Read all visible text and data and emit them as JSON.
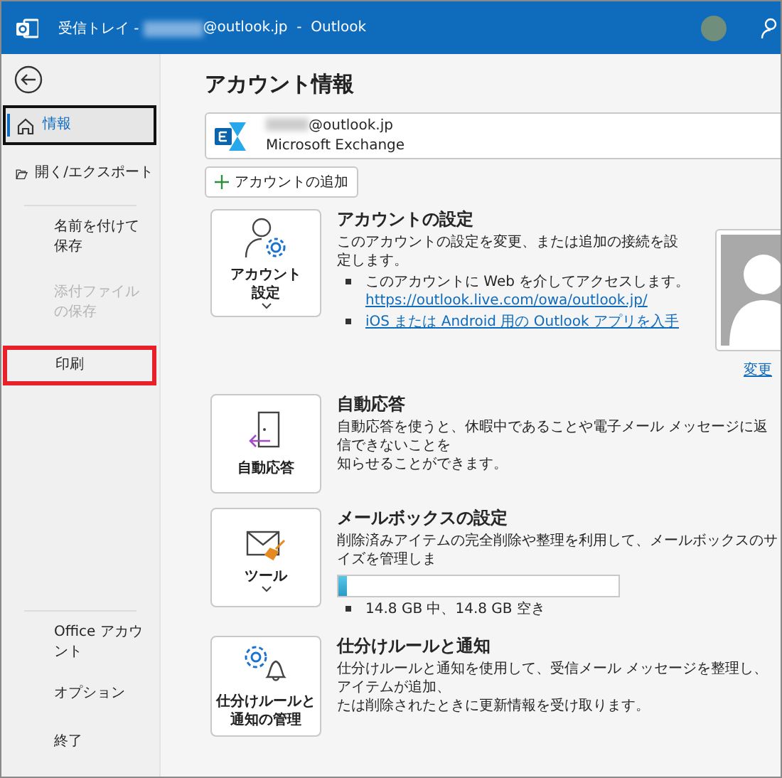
{
  "window": {
    "title_prefix": "受信トレイ -",
    "title_suffix": "@outlook.jp  -  Outlook"
  },
  "sidebar": {
    "top_items": [
      {
        "label": "情報",
        "selected": true,
        "disabled": false,
        "highlighted": false
      },
      {
        "label": "開く/エクスポート",
        "selected": false,
        "disabled": false,
        "highlighted": false
      }
    ],
    "file_items": [
      {
        "label": "名前を付けて保存",
        "selected": false,
        "disabled": false,
        "highlighted": false
      },
      {
        "label": "添付ファイルの保存",
        "selected": false,
        "disabled": true,
        "highlighted": false
      },
      {
        "label": "印刷",
        "selected": false,
        "disabled": false,
        "highlighted": true
      }
    ],
    "bottom_items": [
      {
        "label": "Office アカウント",
        "selected": false,
        "disabled": false,
        "highlighted": false
      },
      {
        "label": "オプション",
        "selected": false,
        "disabled": false,
        "highlighted": false
      },
      {
        "label": "終了",
        "selected": false,
        "disabled": false,
        "highlighted": false
      }
    ]
  },
  "main": {
    "heading": "アカウント情報",
    "account": {
      "email": "@outlook.jp",
      "type": "Microsoft Exchange"
    },
    "add_account": "アカウントの追加",
    "cards": [
      {
        "kind": "account-settings",
        "button": [
          "アカウント",
          "設定"
        ],
        "dropdown": true,
        "title": "アカウントの設定",
        "description": [
          "このアカウントの設定を変更、または追加の接続を設定します。"
        ],
        "bullets": [
          {
            "text": "このアカウントに Web を介してアクセスします。",
            "link": "https://outlook.live.com/owa/outlook.jp/"
          },
          {
            "link": "iOS または Android 用の Outlook アプリを入手"
          }
        ],
        "photo_link": "変更"
      },
      {
        "kind": "auto-reply",
        "button": [
          "自動応答"
        ],
        "dropdown": false,
        "title": "自動応答",
        "description": [
          "自動応答を使うと、休暇中であることや電子メール メッセージに返信できないことを",
          "知らせることができます。"
        ]
      },
      {
        "kind": "mailbox",
        "button": [
          "ツール"
        ],
        "dropdown": true,
        "title": "メールボックスの設定",
        "description": [
          "削除済みアイテムの完全削除や整理を利用して、メールボックスのサイズを管理しま"
        ],
        "usage": {
          "level": 0.03
        },
        "bullets": [
          {
            "text": "14.8 GB 中、14.8 GB 空き"
          }
        ]
      },
      {
        "kind": "rules",
        "button": [
          "仕分けルールと",
          "通知の管理"
        ],
        "dropdown": false,
        "title": "仕分けルールと通知",
        "description": [
          "仕分けルールと通知を使用して、受信メール メッセージを整理し、アイテムが追加、",
          "たは削除されたときに更新情報を受け取ります。"
        ]
      }
    ]
  }
}
